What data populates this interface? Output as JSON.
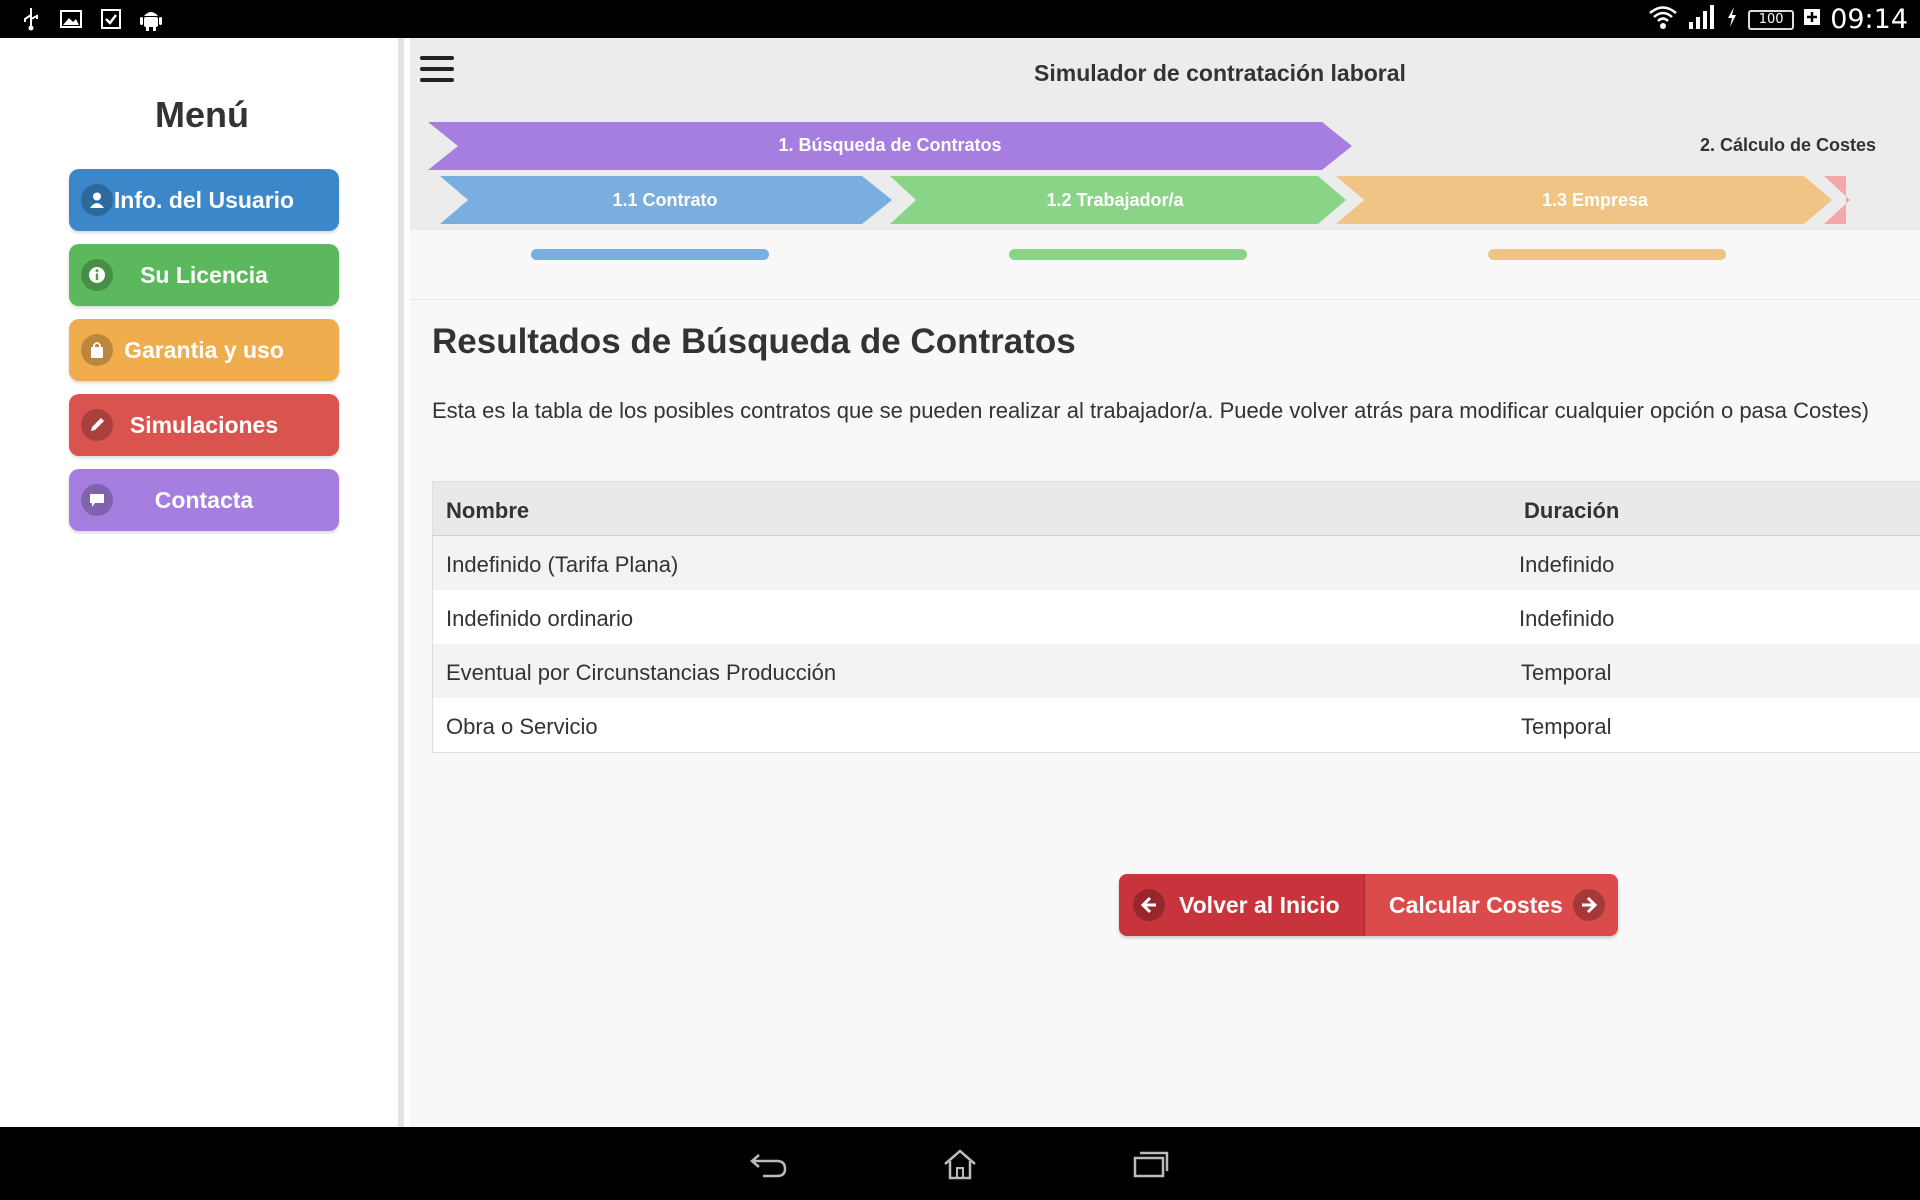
{
  "status_bar": {
    "time": "09:14",
    "battery": "100"
  },
  "sidebar": {
    "title": "Menú",
    "items": [
      {
        "label": "Info. del Usuario",
        "icon": "user-icon",
        "color": "#3b87c9"
      },
      {
        "label": "Su Licencia",
        "icon": "info-icon",
        "color": "#5cb85c"
      },
      {
        "label": "Garantia y uso",
        "icon": "shopping-bag-icon",
        "color": "#efad4d"
      },
      {
        "label": "Simulaciones",
        "icon": "pencil-icon",
        "color": "#d9534f"
      },
      {
        "label": "Contacta",
        "icon": "chat-icon",
        "color": "#a57ee0"
      }
    ]
  },
  "header": {
    "title": "Simulador de contratación laboral"
  },
  "steps": {
    "main": [
      {
        "label": "1. Búsqueda de Contratos",
        "color": "#a57ee0"
      },
      {
        "label": "2. Cálculo de Costes"
      }
    ],
    "sub": [
      {
        "label": "1.1 Contrato",
        "color": "#7aaedf"
      },
      {
        "label": "1.2 Trabajador/a",
        "color": "#89d487"
      },
      {
        "label": "1.3 Empresa",
        "color": "#efc485"
      }
    ]
  },
  "content": {
    "title": "Resultados de Búsqueda de Contratos",
    "description": "Esta es la tabla de los posibles contratos que se pueden realizar al trabajador/a. Puede volver atrás para modificar cualquier opción o pasa Costes)"
  },
  "table": {
    "columns": [
      "Nombre",
      "Duración"
    ],
    "rows": [
      [
        "Indefinido (Tarifa Plana)",
        "Indefinido"
      ],
      [
        "Indefinido ordinario",
        "Indefinido"
      ],
      [
        "Eventual por Circunstancias Producción",
        "Temporal"
      ],
      [
        "Obra o Servicio",
        "Temporal"
      ]
    ]
  },
  "actions": {
    "back_label": "Volver al Inicio",
    "calc_label": "Calcular Costes"
  }
}
